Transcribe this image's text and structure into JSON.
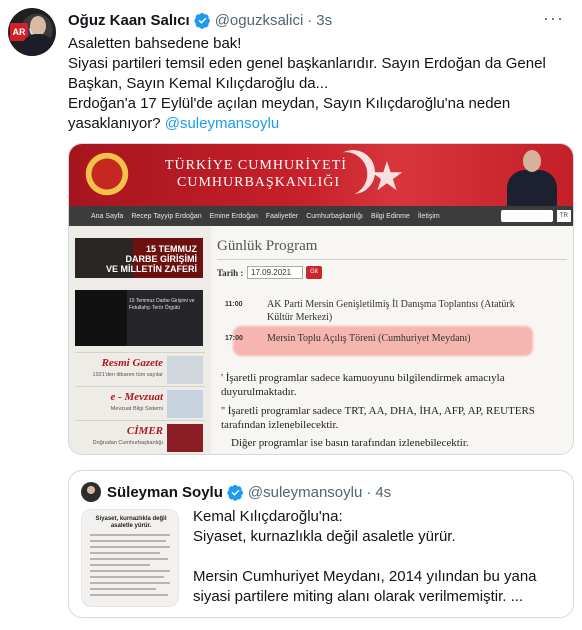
{
  "tweet": {
    "name": "Oğuz Kaan Salıcı",
    "handle": "@oguzksalici",
    "separator": "·",
    "time": "3s",
    "more": "···",
    "lines": [
      "Asaletten bahsedene bak!",
      "Siyasi partileri temsil eden genel başkanlarıdır. Sayın Erdoğan da Genel Başkan, Sayın Kemal Kılıçdaroğlu da...",
      "Erdoğan'a 17 Eylül'de açılan meydan, Sayın Kılıçdaroğlu'na neden yasaklanıyor? "
    ],
    "mention": "@suleymansoylu",
    "avatar_badge": "AR"
  },
  "media": {
    "banner_line1": "TÜRKİYE CUMHURİYETİ",
    "banner_line2": "CUMHURBAŞKANLIĞI",
    "nav": [
      "Ana Sayfa",
      "Recep Tayyip Erdoğan",
      "Emine Erdoğan",
      "Faaliyetler",
      "Cumhurbaşkanlığı",
      "Bilgi Edinme",
      "İletişim"
    ],
    "lang": "TR",
    "promo1": "15 TEMMUZ\nDARBE GİRİŞİMİ\nVE MİLLETİN ZAFERİ",
    "promo2": "15 Temmuz Darbe Girişimi ve Fetullahçı Terör Örgütü",
    "side_links": [
      {
        "label": "Resmi Gazete",
        "sub": "1921'den itibaren tüm sayılar"
      },
      {
        "label": "e - Mevzuat",
        "sub": "Mevzuat Bilgi Sistemi"
      },
      {
        "label": "CİMER",
        "sub": "Doğrudan Cumhurbaşkanlığı"
      }
    ],
    "program_title": "Günlük Program",
    "date_label": "Tarih :",
    "date_value": "17.09.2021",
    "go": "Git",
    "events": [
      {
        "time": "11:00",
        "text": "AK Parti Mersin Genişletilmiş İl Danışma Toplantısı (Atatürk Kültür Merkezi)"
      },
      {
        "time": "17:00",
        "text": "Mersin Toplu Açılış Töreni (Cumhuriyet Meydanı)"
      }
    ],
    "notes": [
      "' İşaretli programlar sadece kamuoyunu bilgilendirmek amacıyla duyurulmaktadır.",
      "'' İşaretli programlar sadece TRT, AA, DHA, İHA, AFP, AP, REUTERS tarafından izlenebilecektir.",
      "Diğer programlar ise basın tarafından izlenebilecektir."
    ]
  },
  "quote": {
    "name": "Süleyman Soylu",
    "handle": "@suleymansoylu",
    "separator": "·",
    "time": "4s",
    "image_heading": "Siyaset, kurnazlıkla değil asaletle yürür.",
    "line1": "Kemal Kılıçdaroğlu'na:",
    "line2": "Siyaset, kurnazlıkla değil asaletle yürür.",
    "line3": "Mersin Cumhuriyet Meydanı, 2014 yılından bu yana siyasi partilere miting alanı olarak verilmemiştir.  ..."
  },
  "colors": {
    "link": "#1d9bf0",
    "secondary_text": "#536471",
    "banner_red": "#c6202a"
  }
}
